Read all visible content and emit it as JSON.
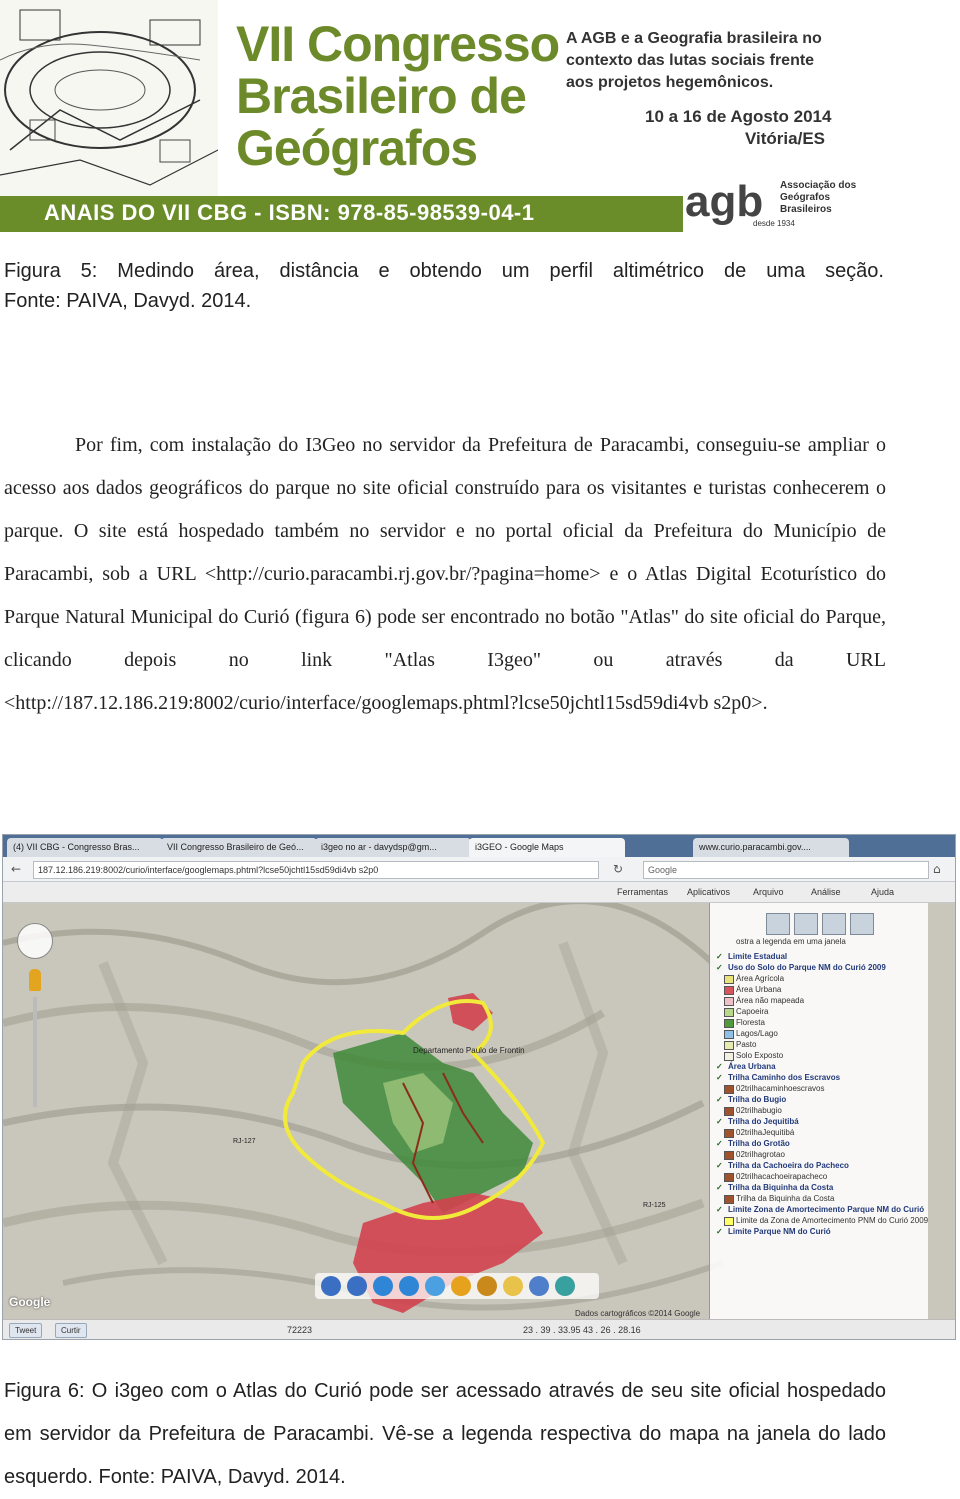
{
  "banner": {
    "title_line1": "VII Congresso",
    "title_line2": "Brasileiro de",
    "title_line3": "Geógrafos",
    "tagline_line1": "A AGB e a Geografia brasileira no",
    "tagline_line2": "contexto das lutas sociais frente",
    "tagline_line3": "aos projetos hegemônicos.",
    "dates": "10 a 16 de Agosto 2014",
    "city": "Vitória/ES",
    "anais": "ANAIS DO VII CBG - ISBN: 978-85-98539-04-1",
    "agb_letters": "agb",
    "agb_since": "desde 1934",
    "agb_name_line1": "Associação dos",
    "agb_name_line2": "Geógrafos",
    "agb_name_line3": "Brasileiros",
    "accent_color": "#6a8d2a"
  },
  "figure5_caption_line1": "Figura 5: Medindo área, distância e obtendo um perfil altimétrico de uma seção.",
  "figure5_caption_line2": "Fonte: PAIVA, Davyd. 2014.",
  "body_paragraph": "Por fim, com instalação do I3Geo no servidor da Prefeitura de Paracambi, conseguiu-se ampliar o acesso aos dados geográficos do parque no site oficial construído para os visitantes e turistas conhecerem o parque. O site está hospedado também no servidor e no portal oficial da Prefeitura do Município de Paracambi, sob a URL <http://curio.paracambi.rj.gov.br/?pagina=home> e o Atlas Digital Ecoturístico do Parque Natural Municipal do Curió (figura 6) pode ser encontrado no botão \"Atlas\" do site oficial do Parque, clicando depois no link \"Atlas I3geo\" ou através da URL <http://187.12.186.219:8002/curio/interface/googlemaps.phtml?lcse50jchtl15sd59di4vb s2p0>.",
  "screenshot": {
    "tabs": [
      "(4) VII CBG - Congresso Bras...",
      "VII Congresso Brasileiro de Geó...",
      "i3geo no ar - davydsp@gm...",
      "i3GEO - Google Maps",
      "www.curio.paracambi.gov...."
    ],
    "url": "187.12.186.219:8002/curio/interface/googlemaps.phtml?lcse50jchtl15sd59di4vb s2p0",
    "search_placeholder": "Google",
    "menu": [
      "Ferramentas",
      "Aplicativos",
      "Arquivo",
      "Análise",
      "Ajuda"
    ],
    "legend_header": "ostra a legenda em uma janela",
    "legend_items": [
      {
        "label": "Limite Estadual",
        "group": true
      },
      {
        "label": "Uso do Solo do Parque NM do Curió 2009",
        "group": true
      },
      {
        "label": "Área Agrícola",
        "group": false,
        "color": "#e8e37a"
      },
      {
        "label": "Área Urbana",
        "group": false,
        "color": "#d9535d"
      },
      {
        "label": "Área não mapeada",
        "group": false,
        "color": "#f0c0c8"
      },
      {
        "label": "Capoeira",
        "group": false,
        "color": "#b9d98a"
      },
      {
        "label": "Floresta",
        "group": false,
        "color": "#4f9a3a"
      },
      {
        "label": "Lagos/Lago",
        "group": false,
        "color": "#8fc1e6"
      },
      {
        "label": "Pasto",
        "group": false,
        "color": "#e7ebb0"
      },
      {
        "label": "Solo Exposto",
        "group": false,
        "color": "#f3efe1"
      },
      {
        "label": "Área Urbana",
        "group": true
      },
      {
        "label": "Trilha Caminho dos Escravos",
        "group": true
      },
      {
        "label": "02trilhacaminhoescravos",
        "group": false,
        "color": "#a0522d"
      },
      {
        "label": "Trilha do Bugio",
        "group": true
      },
      {
        "label": "02trilhabugio",
        "group": false,
        "color": "#a0522d"
      },
      {
        "label": "Trilha do Jequitibá",
        "group": true
      },
      {
        "label": "02trilhaJequitibá",
        "group": false,
        "color": "#a0522d"
      },
      {
        "label": "Trilha do Grotão",
        "group": true
      },
      {
        "label": "02trilhagrotao",
        "group": false,
        "color": "#a0522d"
      },
      {
        "label": "Trilha da Cachoeira do Pacheco",
        "group": true
      },
      {
        "label": "02trilhacachoeirapacheco",
        "group": false,
        "color": "#a0522d"
      },
      {
        "label": "Trilha da Biquinha da Costa",
        "group": true
      },
      {
        "label": "Trilha da Biquinha da Costa",
        "group": false,
        "color": "#a0522d"
      },
      {
        "label": "Limite Zona de Amortecimento Parque NM do Curió",
        "group": true
      },
      {
        "label": "Limite da Zona de Amortecimento PNM do Curió 2009",
        "group": false,
        "color": "#ffff66"
      },
      {
        "label": "Limite Parque NM do Curió",
        "group": true
      }
    ],
    "map_labels": [
      "Departamento Paulo de Frontin",
      "RJ-125",
      "RJ-127"
    ],
    "status_buttons": [
      "Tweet",
      "Curtir"
    ],
    "status_value": "72223",
    "coords": "23 . 39 . 33.95 43 . 26 . 28.16",
    "credit": "Dados cartográficos ©2014 Google",
    "google_mark": "Google"
  },
  "figure6_caption": "Figura 6: O i3geo com o Atlas do Curió pode ser acessado através de seu site oficial hospedado em servidor da Prefeitura de Paracambi. Vê-se a legenda respectiva do mapa na janela do lado esquerdo. Fonte: PAIVA, Davyd. 2014."
}
